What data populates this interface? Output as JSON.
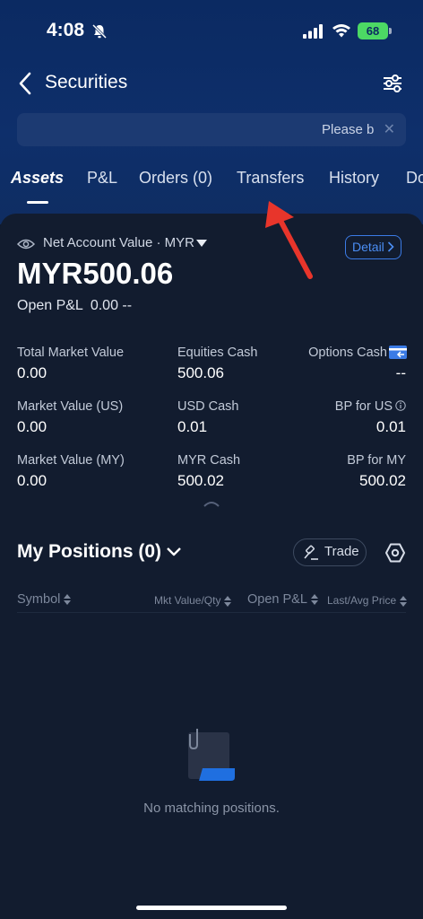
{
  "status_bar": {
    "time": "4:08",
    "battery": "68"
  },
  "nav": {
    "title": "Securities"
  },
  "marquee": {
    "text": "Please b"
  },
  "tabs": [
    {
      "label": "Assets",
      "active": true
    },
    {
      "label": "P&L"
    },
    {
      "label": "Orders (0)"
    },
    {
      "label": "Transfers"
    },
    {
      "label": "History"
    },
    {
      "label": "Do"
    }
  ],
  "account": {
    "label": "Net Account Value · MYR",
    "detail_label": "Detail",
    "total_value": "MYR500.06",
    "open_pl_label": "Open P&L",
    "open_pl_value": "0.00 --"
  },
  "metrics": [
    {
      "label": "Total Market Value",
      "value": "0.00"
    },
    {
      "label": "Equities Cash",
      "value": "500.06"
    },
    {
      "label": "Options Cash",
      "value": "--"
    },
    {
      "label": "Market Value (US)",
      "value": "0.00"
    },
    {
      "label": "USD Cash",
      "value": "0.01"
    },
    {
      "label": "BP for US",
      "value": "0.01"
    },
    {
      "label": "Market Value (MY)",
      "value": "0.00"
    },
    {
      "label": "MYR Cash",
      "value": "500.02"
    },
    {
      "label": "BP for MY",
      "value": "500.02"
    }
  ],
  "positions": {
    "title": "My Positions (0)",
    "trade_label": "Trade",
    "columns": [
      "Symbol",
      "Mkt Value/Qty",
      "Open P&L",
      "Last/Avg Price"
    ],
    "empty_text": "No matching positions."
  },
  "colors": {
    "accent": "#3b7be6",
    "annotation_arrow": "#e8352b",
    "header_bg": "#0e2f6b",
    "card_bg": "#121c2f"
  },
  "icons": [
    "bell-off-icon",
    "signal-icon",
    "wifi-icon",
    "back-arrow-icon",
    "filter-settings-icon",
    "close-icon",
    "eye-icon",
    "caret-down-icon",
    "chevron-right-icon",
    "card-icon",
    "info-icon",
    "chevron-up-icon",
    "hammer-icon",
    "hexagon-settings-icon",
    "sort-icon",
    "empty-document-icon"
  ]
}
